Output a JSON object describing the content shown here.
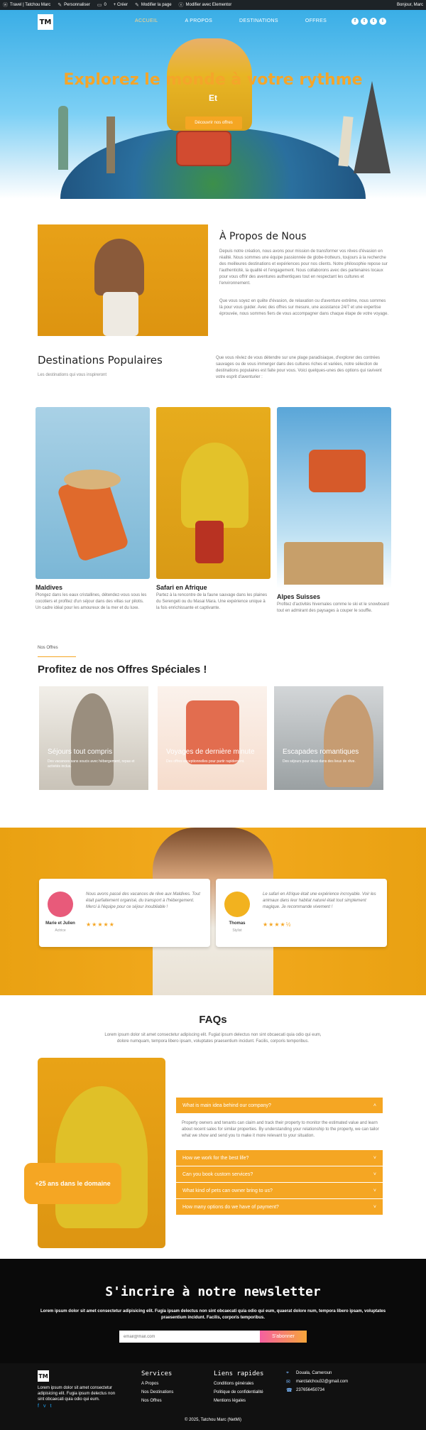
{
  "admin_bar": {
    "items": [
      "Travel | Tatchou Marc",
      "Personnaliser",
      "0",
      "+ Créer",
      "Modifier la page",
      "Modifier avec Elementor"
    ],
    "right": "Bonjour, Marc"
  },
  "logo_text": "TM",
  "nav": {
    "items": [
      "ACCUEIL",
      "A PROPOS",
      "DESTINATIONS",
      "OFFRES"
    ]
  },
  "social": [
    "f",
    "t",
    "t",
    "i"
  ],
  "hero": {
    "title": "Explorez le monde à votre rythme",
    "subtitle": "Et",
    "button": "Découvrir nos offres"
  },
  "about": {
    "title": "À Propos de Nous",
    "p1": "Depuis notre création, nous avons pour mission de transformer vos rêves d'évasion en réalité. Nous sommes une équipe passionnée de globe-trotteurs, toujours à la recherche des meilleures destinations et expériences pour nos clients. Notre philosophie repose sur l'authenticité, la qualité et l'engagement. Nous collaborons avec des partenaires locaux pour vous offrir des aventures authentiques tout en respectant les cultures et l'environnement.",
    "p2": "Que vous soyez en quête d'évasion, de relaxation ou d'aventure extrême, nous sommes là pour vous guider. Avec des offres sur mesure, une assistance 24/7 et une expertise éprouvée, nous sommes fiers de vous accompagner dans chaque étape de votre voyage."
  },
  "destinations": {
    "title": "Destinations Populaires",
    "subtitle": "Les destinations qui vous inspireront",
    "description": "Que vous rêviez de vous détendre sur une plage paradisiaque, d'explorer des contrées sauvages ou de vous immerger dans des cultures riches et variées, notre sélection de destinations populaires est faite pour vous. Voici quelques-unes des options qui ravivent votre esprit d'aventurier :",
    "cards": [
      {
        "title": "Maldives",
        "text": "Plongez dans les eaux cristallines, détendez-vous sous les cocotiers et profitez d'un séjour dans des villas sur pilotis. Un cadre idéal pour les amoureux de la mer et du luxe."
      },
      {
        "title": "Safari en Afrique",
        "text": "Partez à la rencontre de la faune sauvage dans les plaines du Serengeti ou du Masai Mara. Une expérience unique à la fois enrichissante et captivante."
      },
      {
        "title": "Alpes Suisses",
        "text": "Profitez d'activités hivernales comme le ski et le snowboard tout en admirant des paysages à couper le souffle."
      }
    ]
  },
  "offers": {
    "kicker": "Nos Offres",
    "title": "Profitez de nos Offres Spéciales !",
    "cards": [
      {
        "label": "Séjours tout compris",
        "text": "Des vacances sans soucis avec hébergement, repas et activités inclus."
      },
      {
        "label": "Voyages de dernière minute",
        "text": "Des offres exceptionnelles pour partir rapidement."
      },
      {
        "label": "Escapades romantiques",
        "text": "Des séjours pour deux dans des lieux de rêve."
      }
    ]
  },
  "testimonials": [
    {
      "quote": "Nous avons passé des vacances de rêve aux Maldives. Tout était parfaitement organisé, du transport à l'hébergement. Merci à l'équipe pour ce séjour inoubliable !",
      "name": "Marie et Julien",
      "role": "Actrice",
      "stars": "★★★★★",
      "avatar_color": "#e85a7a"
    },
    {
      "quote": "Le safari en Afrique était une expérience incroyable. Voir les animaux dans leur habitat naturel était tout simplement magique. Je recommande vivement !",
      "name": "Thomas",
      "role": "Stylist",
      "stars": "★★★★½",
      "avatar_color": "#f2b21f"
    }
  ],
  "faq": {
    "title": "FAQs",
    "intro": "Lorem ipsum dolor sit amet consectetur adipiscing elit. Fugiat ipsum delectus non sint obcaecati quia odio qui eum, dolore numquam, tempora libero ipsam, voluptates praesentium incidunt. Facilis, corporis temporibus.",
    "badge": "+25 ans dans le domaine",
    "questions": [
      "What is main idea behind our company?",
      "How we work for the best life?",
      "Can you book custom services?",
      "What kind of pets can owner bring to us?",
      "How many options do we have of payment?"
    ],
    "answer": "Property owners and tenants can claim and track their property to monitor the estimated value and learn about recent sales for similar properties. By understanding your relationship to the property, we can tailor what we show and send you to make it more relevant to your situation."
  },
  "newsletter": {
    "title": "S'incrire à notre newsletter",
    "text": "Lorem ipsum dolor sit amet consectetur adipisicing elit. Fugia ipsam delectus non sint obcaecati quia odio qui eum, quaerat dolore num, tempora libero ipsam, voluptates praesentium incidunt. Facilis, corporis temporibus.",
    "placeholder": "email@mail.com",
    "button": "S'abonner"
  },
  "footer": {
    "about": "Lorem ipsum dolor sit amet consectetur adipisicing elit. Fugia ipsum delectus non sint obcaecati quia odio qui eum.",
    "social": [
      "f",
      "v",
      "t"
    ],
    "services_title": "Services",
    "services": [
      "A Propos",
      "Nos Destinations",
      "Nos Offres"
    ],
    "links_title": "Liens rapides",
    "links": [
      "Conditions générales",
      "Politique de confidentialité",
      "Mentions légales"
    ],
    "contacts": [
      {
        "icon": "map-pin-icon",
        "glyph": "⌖",
        "text": "Douala, Cameroun"
      },
      {
        "icon": "email-icon",
        "glyph": "✉",
        "text": "marctatchou32@gmail.com"
      },
      {
        "icon": "phone-icon",
        "glyph": "☎",
        "text": "237656450734"
      }
    ],
    "copyright": "© 2025, Tatchou Marc (NetMi)"
  },
  "colors": {
    "accent": "#f5a623",
    "hero_title": "#f4a52a",
    "dark": "#0a0a0a"
  }
}
